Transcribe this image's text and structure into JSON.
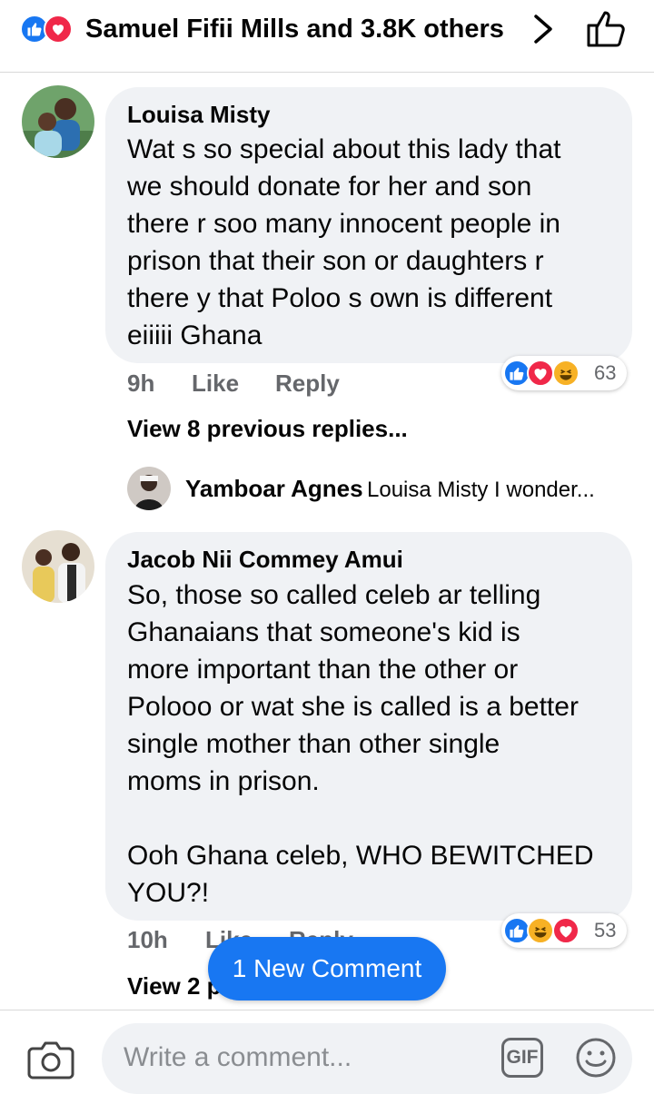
{
  "header": {
    "reaction_icons": [
      "like-icon",
      "love-icon"
    ],
    "reactors_text": "Samuel Fifii Mills and 3.8K others",
    "chevron_icon": "chevron-right-icon",
    "like_button_icon": "thumbs-up-icon"
  },
  "comments": [
    {
      "author": "Louisa Misty",
      "lines": [
        "Wat s so special about this lady that",
        "we should donate for her and son",
        "there r soo many innocent people in",
        "prison that their son or daughters r",
        "there y that Poloo s own is different",
        "eiiiii Ghana"
      ],
      "time": "9h",
      "like_label": "Like",
      "reply_label": "Reply",
      "reactions": [
        "like-icon",
        "love-icon",
        "haha-icon"
      ],
      "reaction_count": "63",
      "view_replies": "View 8 previous replies...",
      "reply_preview": {
        "author": "Yamboar Agnes",
        "text": "Louisa Misty I wonder..."
      }
    },
    {
      "author": "Jacob Nii Commey Amui",
      "lines": [
        "So, those so called celeb ar telling",
        "Ghanaians that someone's kid is",
        "more important than the other or",
        "Polooo or wat she is called is a better",
        "single mother than other single",
        "moms in prison.",
        "",
        "Ooh Ghana celeb, WHO BEWITCHED",
        "YOU?!"
      ],
      "time": "10h",
      "like_label": "Like",
      "reply_label": "Reply",
      "reactions": [
        "like-icon",
        "haha-icon",
        "love-icon"
      ],
      "reaction_count": "53",
      "view_replies": "View 2 p"
    }
  ],
  "toast": {
    "label": "1 New Comment"
  },
  "composer": {
    "camera_icon": "camera-icon",
    "placeholder": "Write a comment...",
    "gif_label": "GIF",
    "emoji_icon": "emoji-icon"
  },
  "colors": {
    "accent": "#1877f2",
    "love": "#f02849",
    "haha": "#f7b125",
    "bubble": "#f0f2f5",
    "meta_text": "#65676b"
  }
}
